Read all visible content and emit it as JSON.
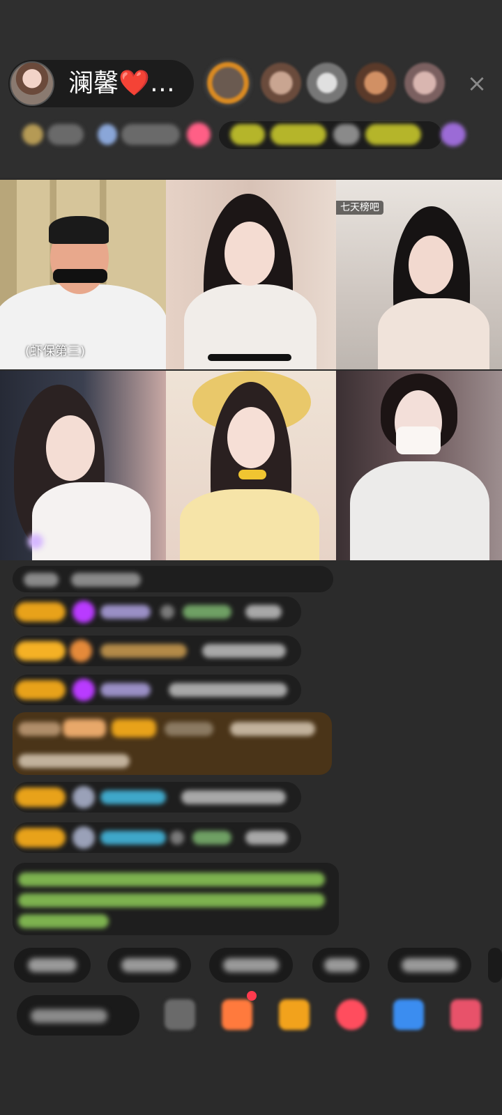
{
  "header": {
    "host_name": "澜馨❤️…",
    "close_icon": "×"
  },
  "tiles": [
    {
      "tag": "",
      "mic_label": "(虾保第三)"
    },
    {
      "tag": ""
    },
    {
      "tag": "七天榜吧"
    },
    {
      "tag": ""
    },
    {
      "tag": ""
    },
    {
      "tag": ""
    }
  ],
  "colors": {
    "background": "#2b2b2b",
    "level_badge": "#e8a21a",
    "gift_name_green": "#9bd35b",
    "user_name_cyan": "#3fa7c9",
    "notify_red": "#ff3b4e"
  }
}
